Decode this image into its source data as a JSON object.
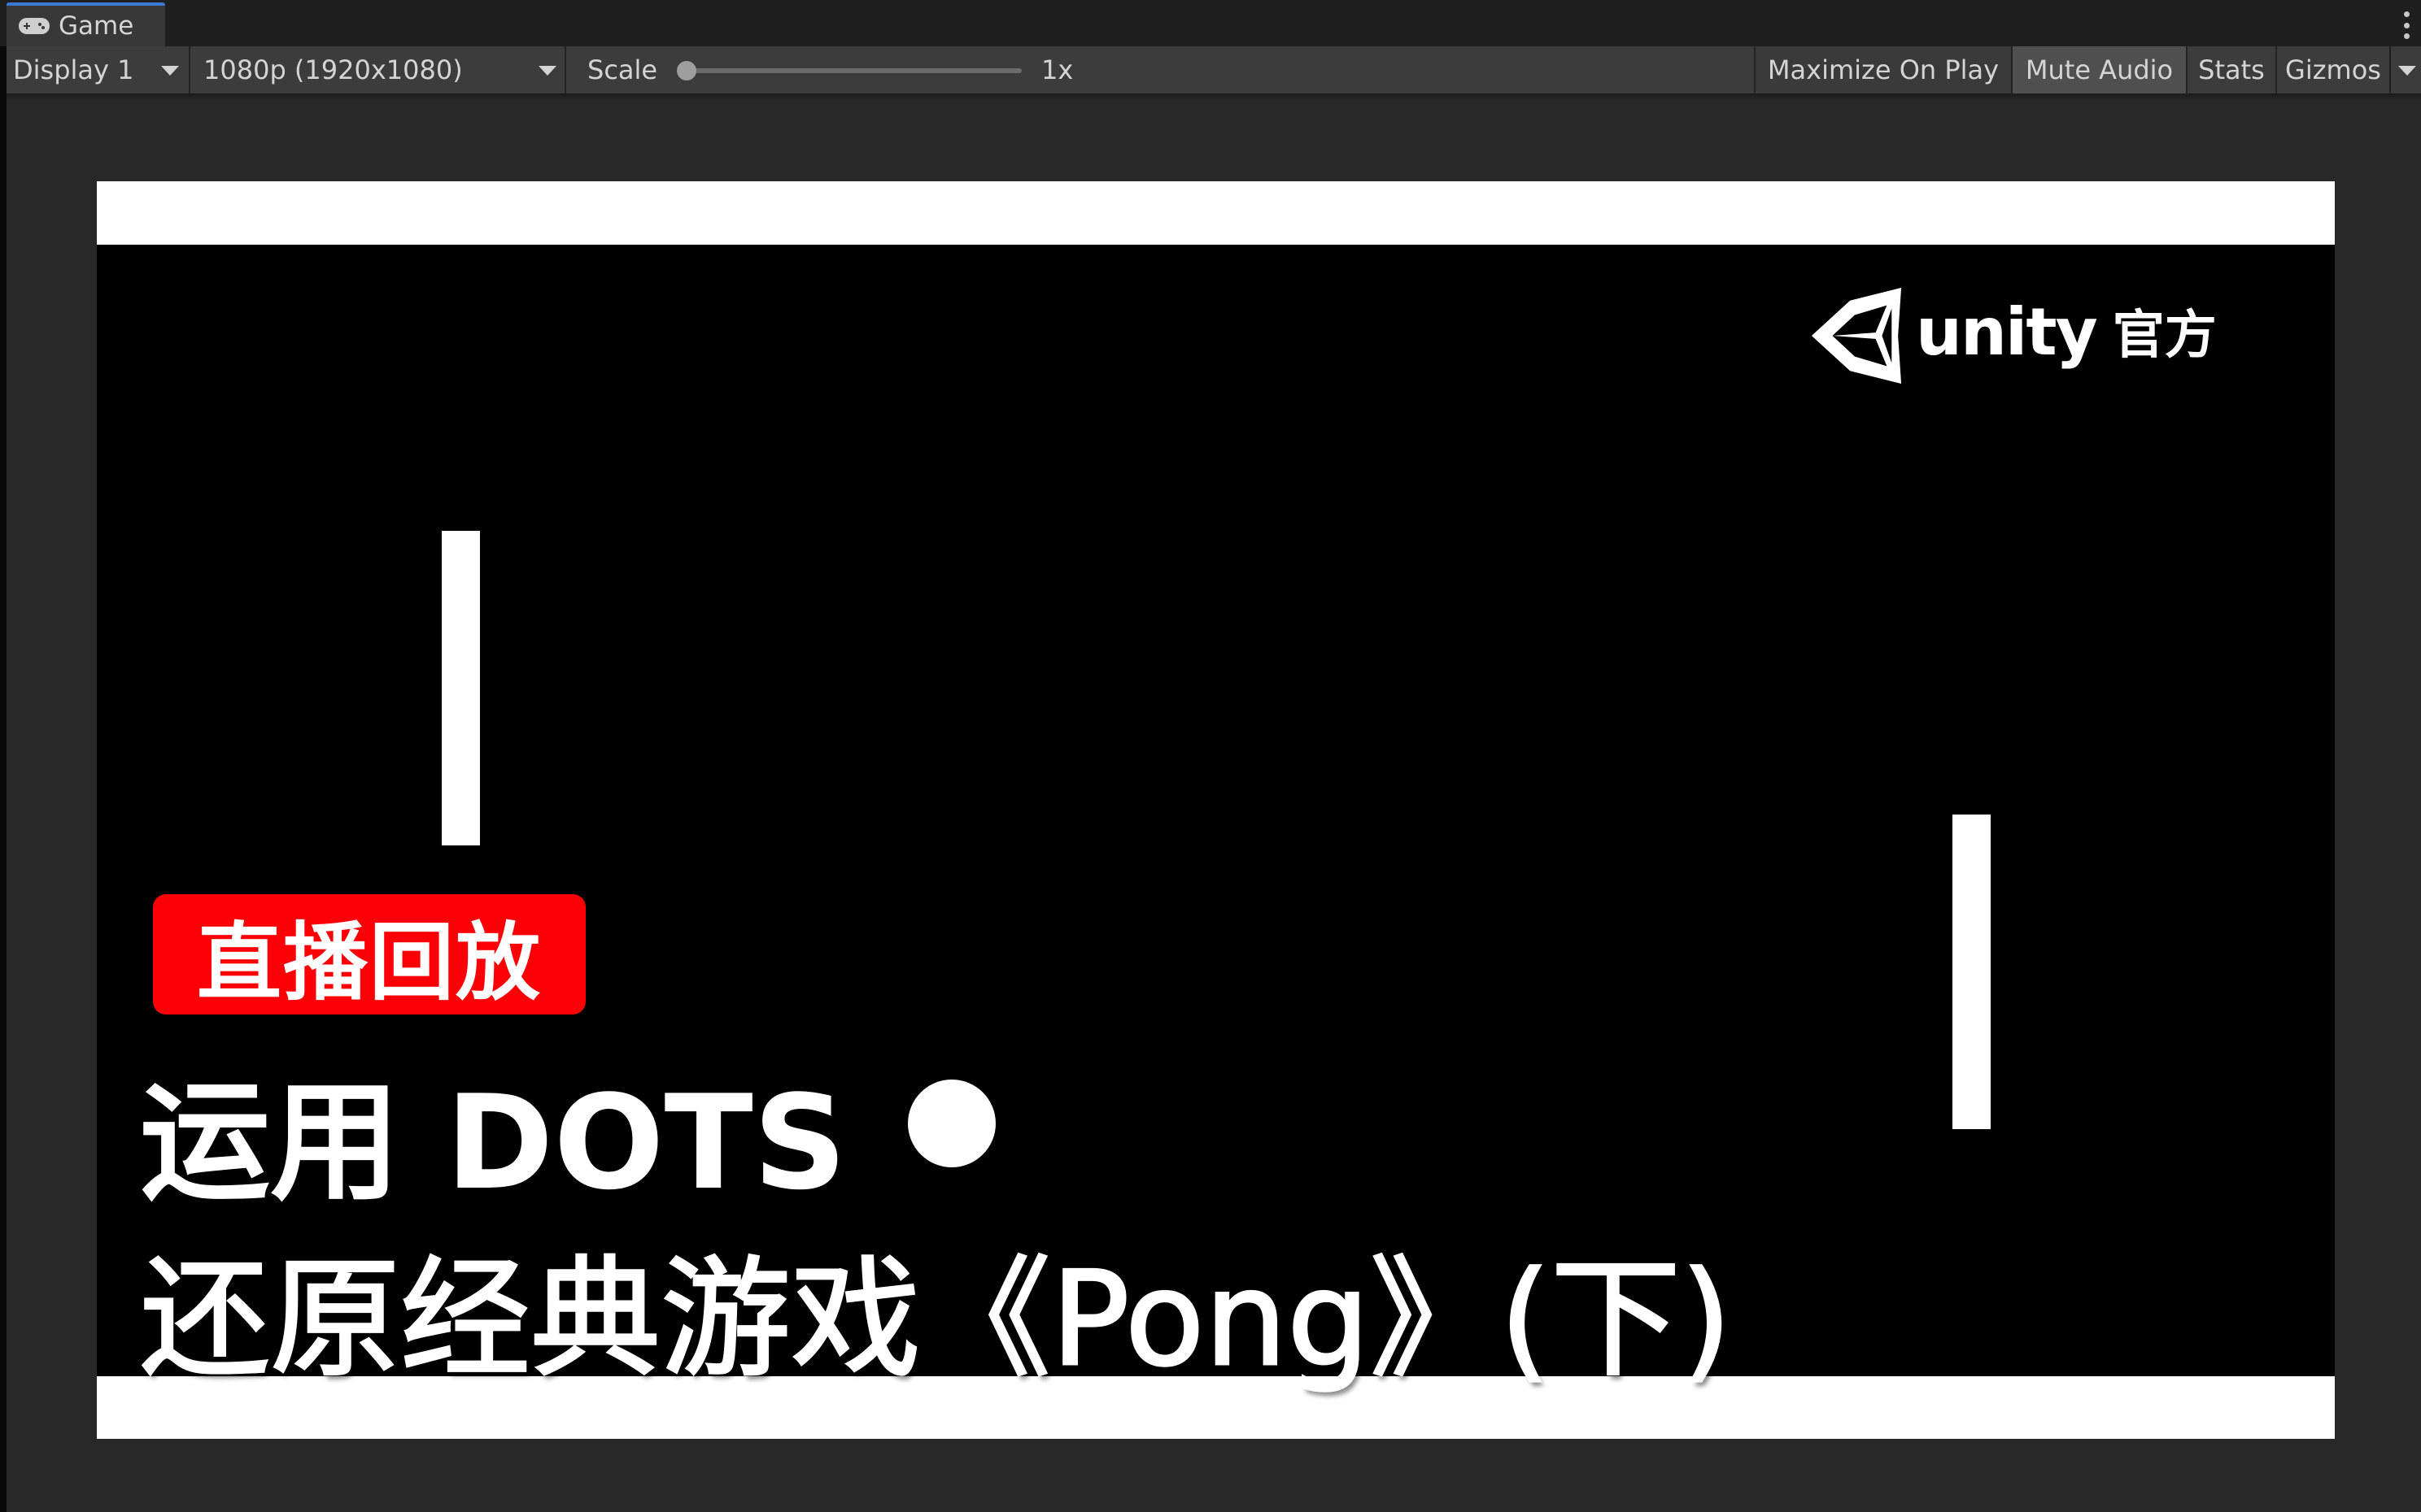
{
  "window": {
    "tab_label": "Game",
    "tab_icon": "gamepad-icon",
    "more_options_icon": "kebab-menu-icon",
    "accent_color": "#3a79d1"
  },
  "toolbar": {
    "display_selected": "Display 1",
    "resolution_selected": "1080p (1920x1080)",
    "scale_label": "Scale",
    "scale_value_label": "1x",
    "scale_slider_fraction": 0.0,
    "maximize_on_play_label": "Maximize On Play",
    "mute_audio_label": "Mute Audio",
    "mute_audio_active": true,
    "stats_label": "Stats",
    "gizmos_label": "Gizmos"
  },
  "game": {
    "background_color": "#000000",
    "foreground_color": "#ffffff",
    "logo": {
      "icon": "unity-cube-icon",
      "wordmark": "unity",
      "suffix": "官方"
    },
    "badge": {
      "text": "直播回放",
      "color": "#fb0007"
    },
    "title_line_1": "运用 DOTS",
    "title_line_2": "还原经典游戏《Pong》(下)"
  }
}
